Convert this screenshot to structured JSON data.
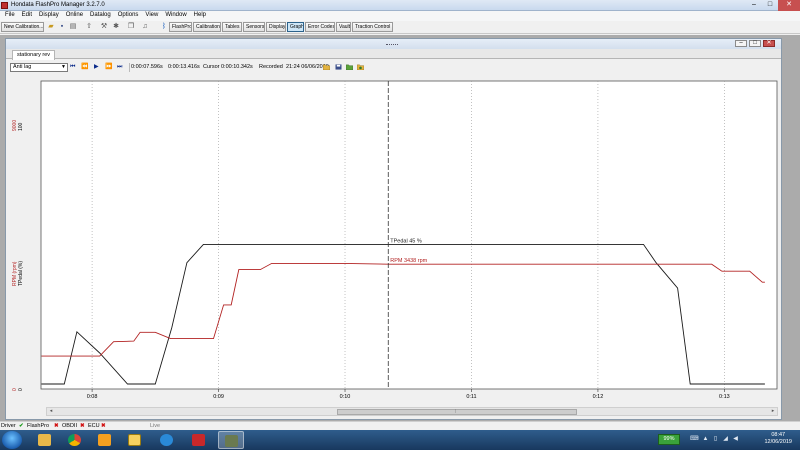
{
  "window": {
    "title": "Hondata FlashPro Manager  3.2.7.0",
    "min": "–",
    "max": "□",
    "close": "✕"
  },
  "menu": [
    "File",
    "Edit",
    "Display",
    "Online",
    "Datalog",
    "Options",
    "View",
    "Window",
    "Help"
  ],
  "toolbar": {
    "new_calibration": "New Calibration...",
    "buttons": [
      "FlashPro",
      "Calibration",
      "Tables",
      "Sensors",
      "Display",
      "Graph",
      "Error Codes",
      "Vault",
      "Traction Control"
    ],
    "active": "Graph"
  },
  "document": {
    "tab": "stationary rev"
  },
  "graph_toolbar": {
    "preset": "Anti lag",
    "time_start": "0:00:07.596s",
    "time_end": "0:00:13.416s",
    "cursor_label": "Cursor",
    "cursor_value": "0:00:10.342s",
    "recorded_label": "Recorded",
    "recorded_value": "21:24 06/06/2019"
  },
  "y_axis": {
    "rpm_label": "RPM (rpm)",
    "tpedal_label": "TPedal (%)",
    "rpm_max": "9000",
    "tpedal_max": "100",
    "rpm_min": "0",
    "tpedal_min": "0"
  },
  "chart_data": {
    "type": "line",
    "x_unit": "time (min:sec)",
    "xlim": [
      7.596,
      13.416
    ],
    "x_tick_labels": [
      "0:08",
      "0:09",
      "0:10",
      "0:11",
      "0:12",
      "0:13"
    ],
    "x_ticks": [
      8,
      9,
      10,
      11,
      12,
      13
    ],
    "cursor_x": 10.342,
    "grid": "vertical-dotted",
    "series": [
      {
        "name": "TPedal",
        "unit": "%",
        "color": "#1a1a1a",
        "ylim": [
          0,
          100
        ],
        "cursor_label": "TPedal 45 %",
        "points": [
          [
            7.6,
            0
          ],
          [
            7.78,
            0
          ],
          [
            7.88,
            37
          ],
          [
            8.06,
            22
          ],
          [
            8.28,
            0
          ],
          [
            8.5,
            0
          ],
          [
            8.63,
            40
          ],
          [
            8.75,
            86
          ],
          [
            8.88,
            99
          ],
          [
            9.2,
            99
          ],
          [
            10.0,
            99
          ],
          [
            10.342,
            99
          ],
          [
            11.5,
            99
          ],
          [
            12.0,
            99
          ],
          [
            12.36,
            99
          ],
          [
            12.46,
            86
          ],
          [
            12.63,
            68
          ],
          [
            12.73,
            0
          ],
          [
            13.0,
            0
          ],
          [
            13.32,
            0
          ]
        ]
      },
      {
        "name": "RPM",
        "unit": "rpm",
        "color": "#b22222",
        "ylim": [
          0,
          9000
        ],
        "cursor_label": "RPM 3438 rpm",
        "points": [
          [
            7.6,
            1780
          ],
          [
            8.06,
            1780
          ],
          [
            8.17,
            2700
          ],
          [
            8.33,
            2740
          ],
          [
            8.38,
            3300
          ],
          [
            8.5,
            3300
          ],
          [
            8.62,
            2900
          ],
          [
            8.72,
            2900
          ],
          [
            8.96,
            2900
          ],
          [
            9.04,
            5050
          ],
          [
            9.1,
            5050
          ],
          [
            9.16,
            7300
          ],
          [
            9.33,
            7300
          ],
          [
            9.42,
            7700
          ],
          [
            10.0,
            7700
          ],
          [
            10.342,
            7650
          ],
          [
            11.0,
            7650
          ],
          [
            12.0,
            7650
          ],
          [
            12.9,
            7650
          ],
          [
            12.98,
            7200
          ],
          [
            13.2,
            7200
          ],
          [
            13.3,
            6500
          ],
          [
            13.32,
            6500
          ]
        ]
      }
    ]
  },
  "status": {
    "driver_label": "Driver",
    "flashpro": "FlashPro",
    "obdii": "OBDII",
    "ecu": "ECU",
    "live": "Live"
  },
  "taskbar": {
    "battery": "99%",
    "time": "08:47",
    "date": "12/06/2019"
  }
}
